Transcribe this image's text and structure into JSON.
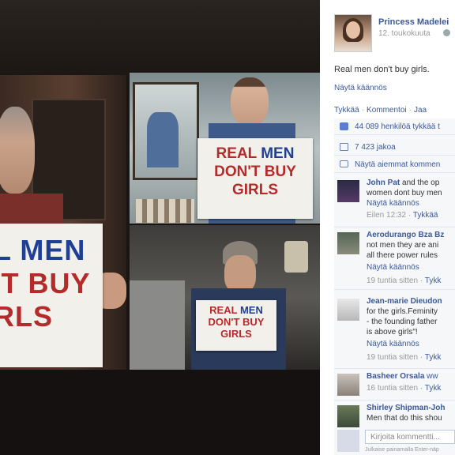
{
  "photo": {
    "signs": {
      "left": {
        "line1": "L MEN",
        "line2": "'T BUY",
        "line3": "RLS"
      },
      "top_right": {
        "line1_real": "REAL",
        "line1_men": "MEN",
        "line2": "DON'T BUY",
        "line3": "GIRLS"
      },
      "bottom_right": {
        "line1_real": "REAL",
        "line1_men": "MEN",
        "line2": "DON'T BUY",
        "line3": "GIRLS"
      }
    }
  },
  "post": {
    "author": "Princess Madelei",
    "date": "12. toukokuuta",
    "text": "Real men don't buy girls.",
    "see_translation": "Näytä käännös",
    "actions": {
      "like": "Tykkää",
      "comment": "Kommentoi",
      "share": "Jaa"
    },
    "likes": "44 089 henkilöä tykkää t",
    "shares": "7 423 jakoa",
    "view_previous": "Näytä aiemmat kommen"
  },
  "comments": [
    {
      "name": "John Pat",
      "line1_suffix": " and the op",
      "line2": "women dont buy men",
      "translate": "Näytä käännös",
      "time": "Eilen 12:32",
      "like": "Tykkää"
    },
    {
      "name": "Aerodurango Bza Bz",
      "line1": "not men they are ani",
      "line2": "all there power rules",
      "translate": "Näytä käännös",
      "time": "19 tuntia sitten",
      "like": "Tykk"
    },
    {
      "name": "Jean-marie Dieudon",
      "line1": "for the girls.Feminity",
      "line2": "- the founding father",
      "line3": "is above girls\"!",
      "translate": "Näytä käännös",
      "time": "19 tuntia sitten",
      "like": "Tykk"
    },
    {
      "name": "Basheer Orsala",
      "name_suffix": " ww",
      "time": "16 tuntia sitten",
      "like": "Tykk"
    },
    {
      "name": "Shirley Shipman-Joh",
      "line1": "Men that do this shou"
    }
  ],
  "write_comment": {
    "placeholder": "Kirjoita kommentti...",
    "note": "Julkaise painamalla Enter-näp"
  },
  "colors": {
    "link": "#3b5998",
    "sign_blue": "#1f3f95",
    "sign_red": "#b52a2a"
  }
}
